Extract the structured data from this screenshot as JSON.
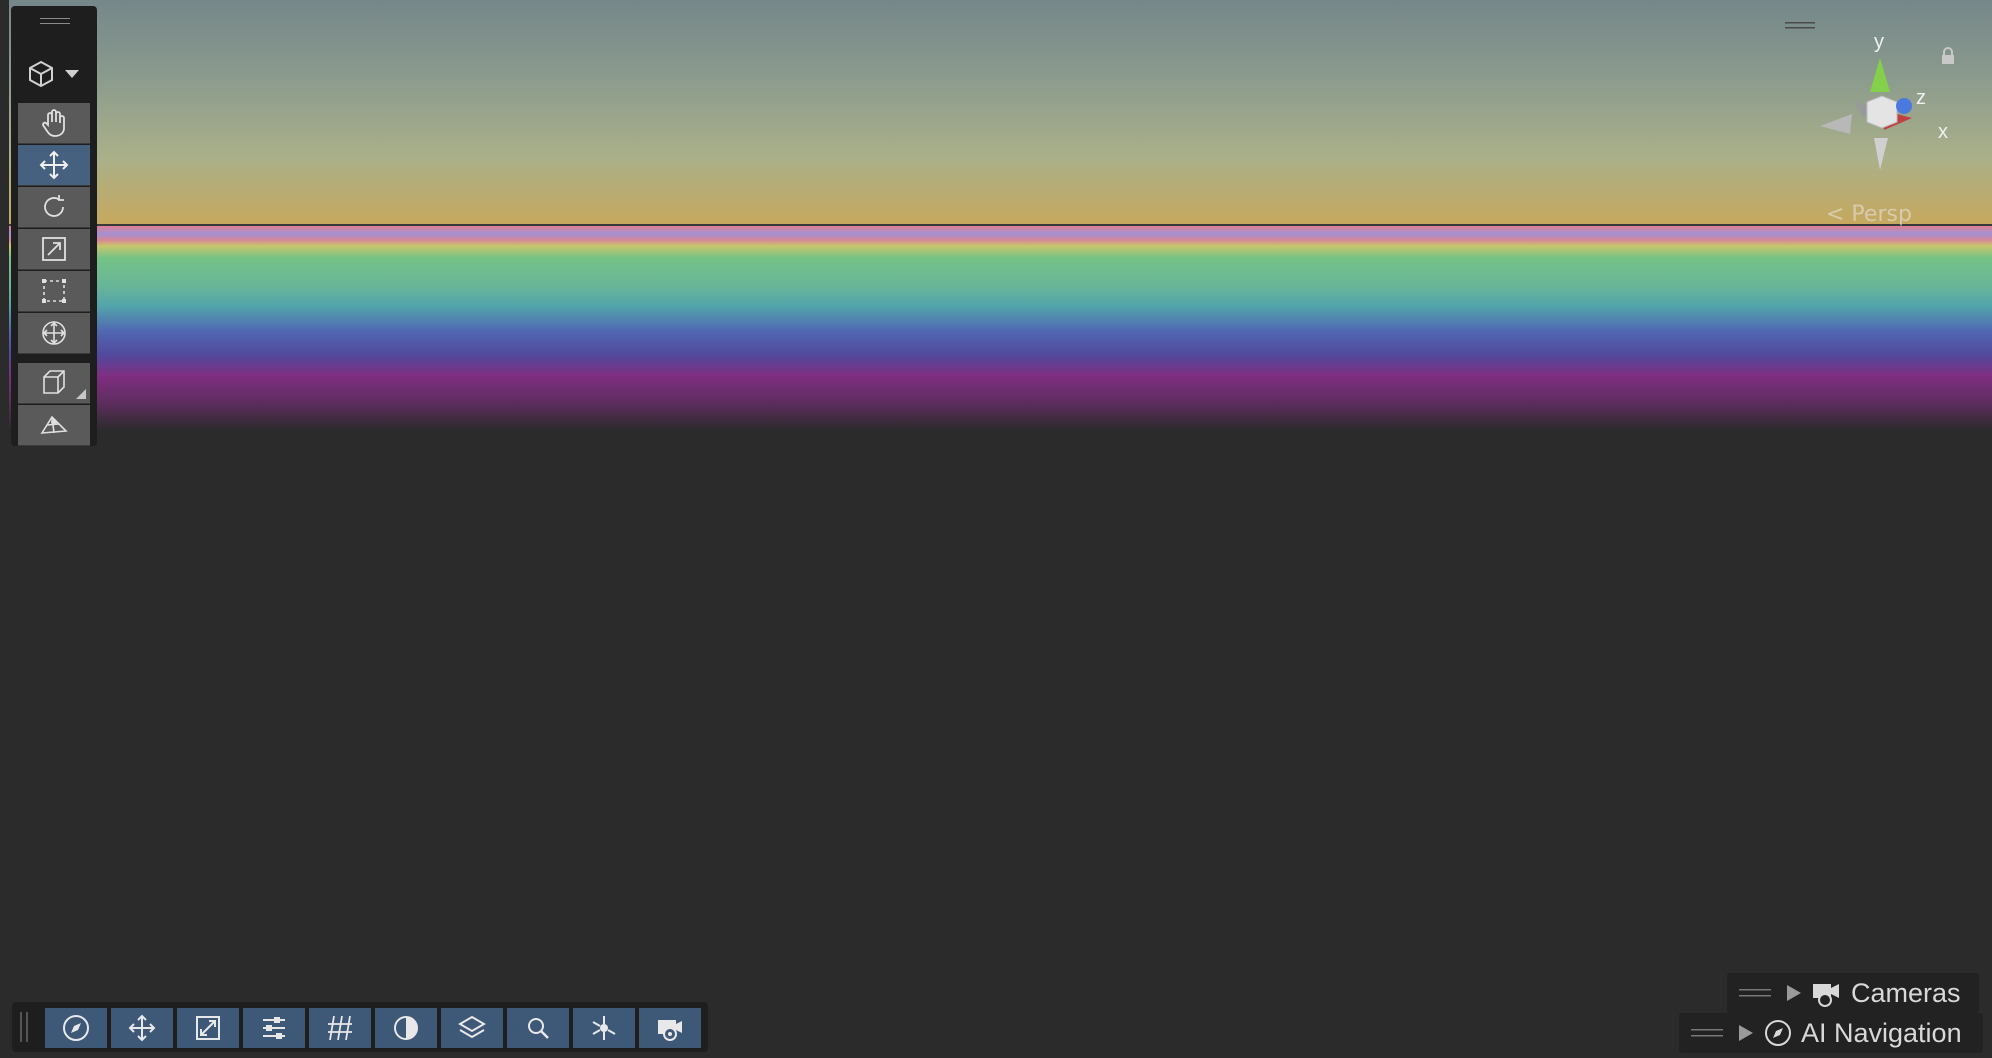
{
  "scene_view": {
    "gizmo": {
      "axis_y": "y",
      "axis_z": "z",
      "axis_x": "x"
    },
    "projection_label": "< Persp"
  },
  "tools": [
    {
      "name": "view-tool",
      "icon": "hand-icon"
    },
    {
      "name": "move-tool",
      "icon": "move-arrows-icon",
      "active": true
    },
    {
      "name": "rotate-tool",
      "icon": "rotate-icon"
    },
    {
      "name": "scale-tool",
      "icon": "scale-icon"
    },
    {
      "name": "rect-tool",
      "icon": "rect-transform-icon"
    },
    {
      "name": "transform-tool",
      "icon": "transform-icon"
    },
    {
      "name": "custom-tool",
      "icon": "cube-outline-icon"
    },
    {
      "name": "navmesh-tool",
      "icon": "navmesh-icon"
    }
  ],
  "bottom_toolbar": [
    {
      "icon": "compass-icon"
    },
    {
      "icon": "move-arrows-icon"
    },
    {
      "icon": "snap-icon"
    },
    {
      "icon": "sliders-icon"
    },
    {
      "icon": "grid-icon"
    },
    {
      "icon": "shading-sphere-icon"
    },
    {
      "icon": "layers-icon"
    },
    {
      "icon": "search-icon"
    },
    {
      "icon": "gizmos-icon"
    },
    {
      "icon": "camera-visibility-icon"
    }
  ],
  "overlays": {
    "cameras": {
      "label": "Cameras"
    },
    "ai_navigation": {
      "label": "AI Navigation"
    }
  },
  "colors": {
    "active_tool": "#46607f",
    "toolbar_button": "#3e5877",
    "floor_light": "#f7aaa6",
    "floor_dark": "#cc6a6a"
  }
}
